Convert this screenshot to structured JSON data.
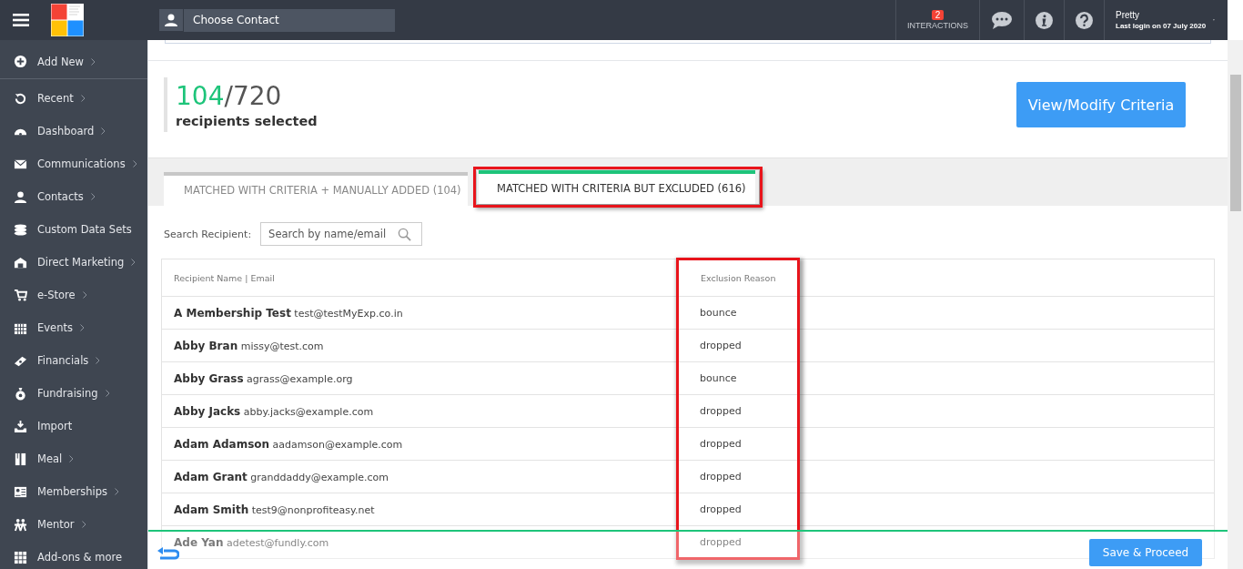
{
  "topbar": {
    "contact_placeholder": "Choose Contact",
    "interactions": {
      "count": "2",
      "label": "INTERACTIONS"
    },
    "user": {
      "name": "Pretty",
      "last_login": "Last login on 07 July 2020"
    }
  },
  "sidebar": {
    "items": [
      {
        "label": "Add New",
        "has_submenu": true
      },
      {
        "label": "Recent",
        "has_submenu": true
      },
      {
        "label": "Dashboard",
        "has_submenu": true
      },
      {
        "label": "Communications",
        "has_submenu": true
      },
      {
        "label": "Contacts",
        "has_submenu": true
      },
      {
        "label": "Custom Data Sets",
        "has_submenu": false
      },
      {
        "label": "Direct Marketing",
        "has_submenu": true
      },
      {
        "label": "e-Store",
        "has_submenu": true
      },
      {
        "label": "Events",
        "has_submenu": true
      },
      {
        "label": "Financials",
        "has_submenu": true
      },
      {
        "label": "Fundraising",
        "has_submenu": true
      },
      {
        "label": "Import",
        "has_submenu": false
      },
      {
        "label": "Meal",
        "has_submenu": true
      },
      {
        "label": "Memberships",
        "has_submenu": true
      },
      {
        "label": "Mentor",
        "has_submenu": true
      },
      {
        "label": "Add-ons & more",
        "has_submenu": false
      }
    ]
  },
  "summary": {
    "selected": "104",
    "total": "/720",
    "caption": "recipients selected",
    "button": "View/Modify Criteria"
  },
  "tabs": [
    {
      "label": "MATCHED WITH CRITERIA + MANUALLY ADDED (104)",
      "selected": false,
      "highlighted": false
    },
    {
      "label": "MATCHED WITH CRITERIA BUT EXCLUDED (616)",
      "selected": true,
      "highlighted": true
    }
  ],
  "search": {
    "label": "Search Recipient:",
    "placeholder": "Search by name/email"
  },
  "table": {
    "columns": [
      {
        "label": "Recipient Name | Email",
        "highlighted": false
      },
      {
        "label": "Exclusion Reason",
        "highlighted": true
      }
    ],
    "rows": [
      {
        "name": "A Membership Test",
        "email": "test@testMyExp.co.in",
        "reason": "bounce"
      },
      {
        "name": "Abby Bran",
        "email": "missy@test.com",
        "reason": "dropped"
      },
      {
        "name": "Abby Grass",
        "email": "agrass@example.org",
        "reason": "bounce"
      },
      {
        "name": "Abby Jacks",
        "email": "abby.jacks@example.com",
        "reason": "dropped"
      },
      {
        "name": "Adam Adamson",
        "email": "aadamson@example.com",
        "reason": "dropped"
      },
      {
        "name": "Adam Grant",
        "email": "granddaddy@example.com",
        "reason": "dropped"
      },
      {
        "name": "Adam Smith",
        "email": "test9@nonprofiteasy.net",
        "reason": "dropped"
      },
      {
        "name": "Ade Yan",
        "email": "adetest@fundly.com",
        "reason": "dropped"
      }
    ]
  },
  "footer": {
    "button": "Save & Proceed"
  }
}
